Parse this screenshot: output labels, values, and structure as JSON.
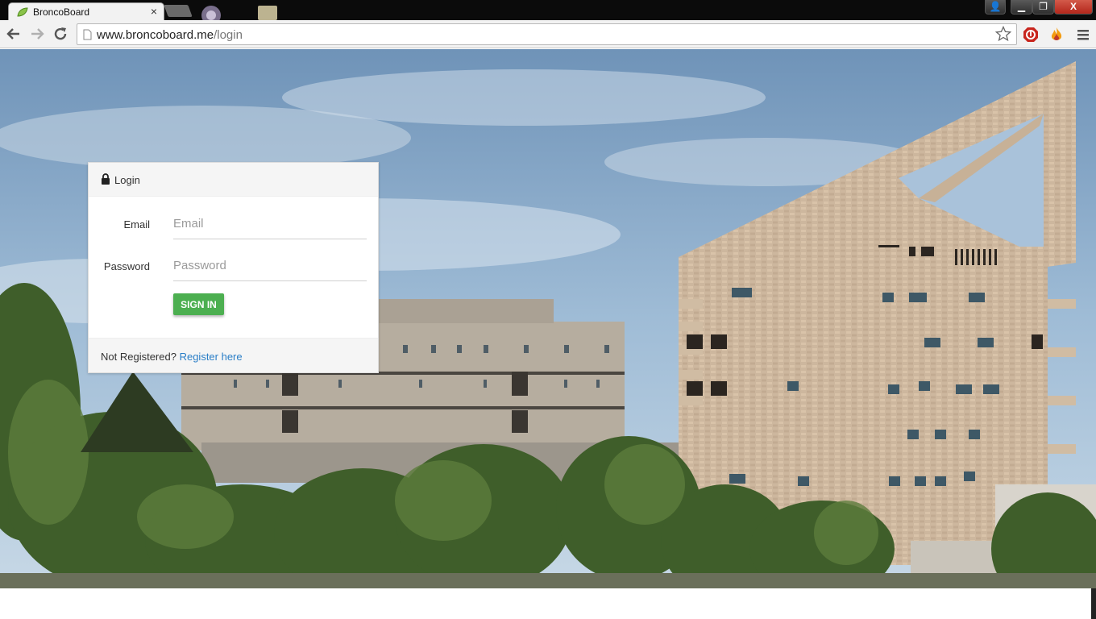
{
  "browser": {
    "tab_title": "BroncoBoard",
    "tab_close": "×",
    "url_host": "www.broncoboard.me",
    "url_path": "/login",
    "window_buttons": {
      "user": "👤",
      "minimize": "▁",
      "maximize": "❐",
      "close": "X"
    }
  },
  "login": {
    "heading": "Login",
    "email_label": "Email",
    "email_placeholder": "Email",
    "password_label": "Password",
    "password_placeholder": "Password",
    "signin_label": "SIGN IN",
    "not_registered": "Not Registered?",
    "register_link": "Register here"
  },
  "colors": {
    "signin_button": "#4caf50",
    "link": "#2a7ec7",
    "panel_header": "#f5f5f5"
  },
  "icons": [
    "back-arrow-icon",
    "forward-arrow-icon",
    "reload-icon",
    "page-icon",
    "bookmark-star-icon",
    "adblock-extension-icon",
    "fire-extension-icon",
    "menu-icon",
    "lock-icon",
    "leaf-favicon"
  ]
}
